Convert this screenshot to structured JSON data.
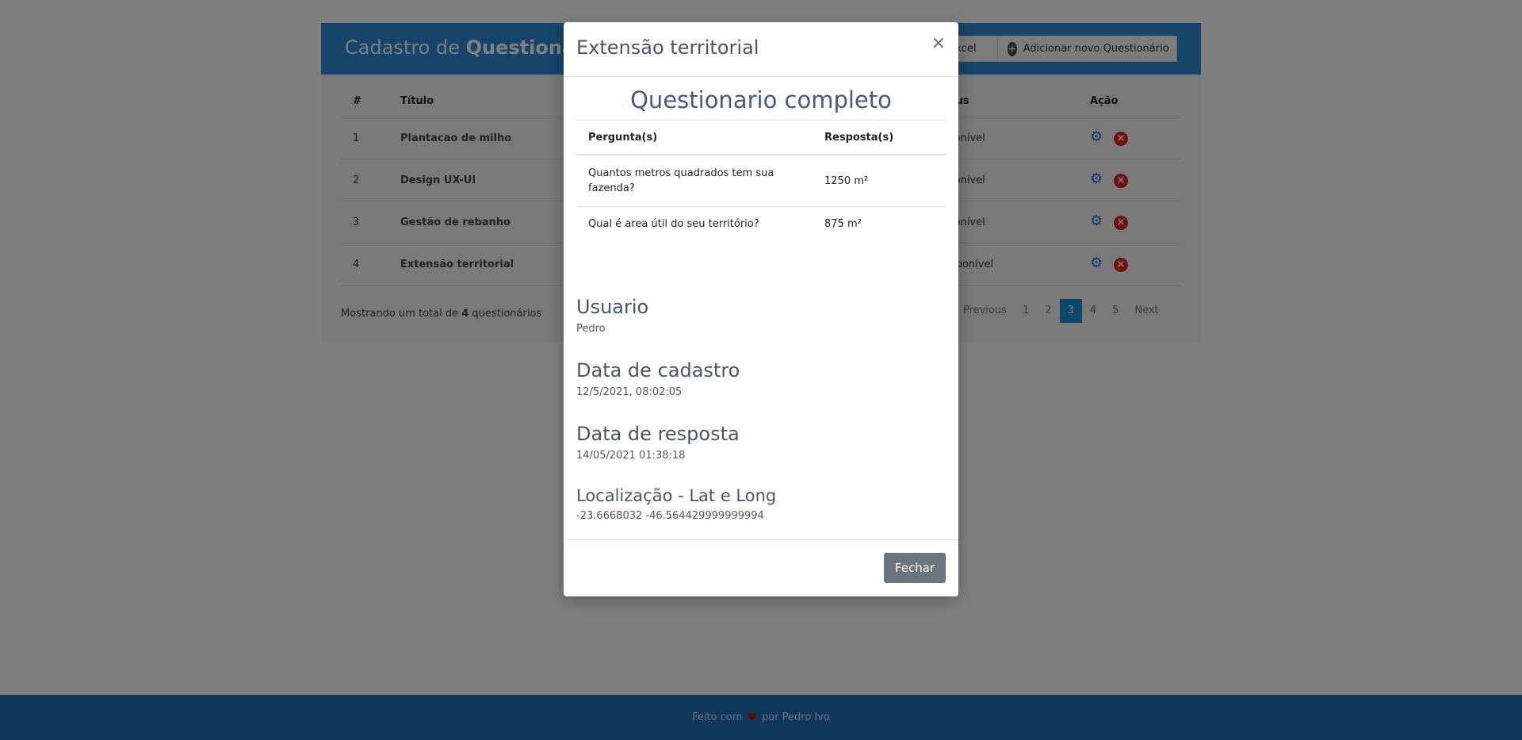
{
  "page": {
    "title_regular": "Cadastro de ",
    "title_bold": "Questionári",
    "excel_button": "Excel",
    "add_button": "Adicionar novo Questionário",
    "columns": [
      "#",
      "Título",
      "Status",
      "Ação"
    ],
    "rows": [
      {
        "num": "1",
        "title": "Plantacao de milho",
        "status": "Disponível"
      },
      {
        "num": "2",
        "title": "Design UX-UI",
        "status": "Disponível"
      },
      {
        "num": "3",
        "title": "Gestão de rebanho",
        "status": "Disponível"
      },
      {
        "num": "4",
        "title": "Extensão territorial",
        "status": "Indisponível"
      }
    ],
    "total_prefix": "Mostrando um total de ",
    "total_count": "4",
    "total_suffix": " questionários",
    "pager": {
      "previous": "Previous",
      "pages": [
        "1",
        "2",
        "3",
        "4",
        "5"
      ],
      "active": "3",
      "next": "Next"
    }
  },
  "footer": {
    "made_with": "Feito com",
    "by": "por Pedro Ivo"
  },
  "modal": {
    "title": "Extensão territorial",
    "close_symbol": "×",
    "heading": "Questionario completo",
    "table_headers": {
      "question": "Pergunta(s)",
      "answer": "Resposta(s)"
    },
    "answers": [
      {
        "question": "Quantos metros quadrados tem sua fazenda?",
        "answer": "1250 m²"
      },
      {
        "question": "Qual é area útil do seu território?",
        "answer": "875 m²"
      }
    ],
    "user_label": "Usuario",
    "user_value": "Pedro",
    "created_label": "Data de cadastro",
    "created_value": "12/5/2021, 08:02:05",
    "answered_label": "Data de resposta",
    "answered_value": "14/05/2021 01:38:18",
    "location_label": "Localização - Lat e Long",
    "location_value": "-23.6668032 -46.564429999999994",
    "close_button": "Fechar"
  }
}
